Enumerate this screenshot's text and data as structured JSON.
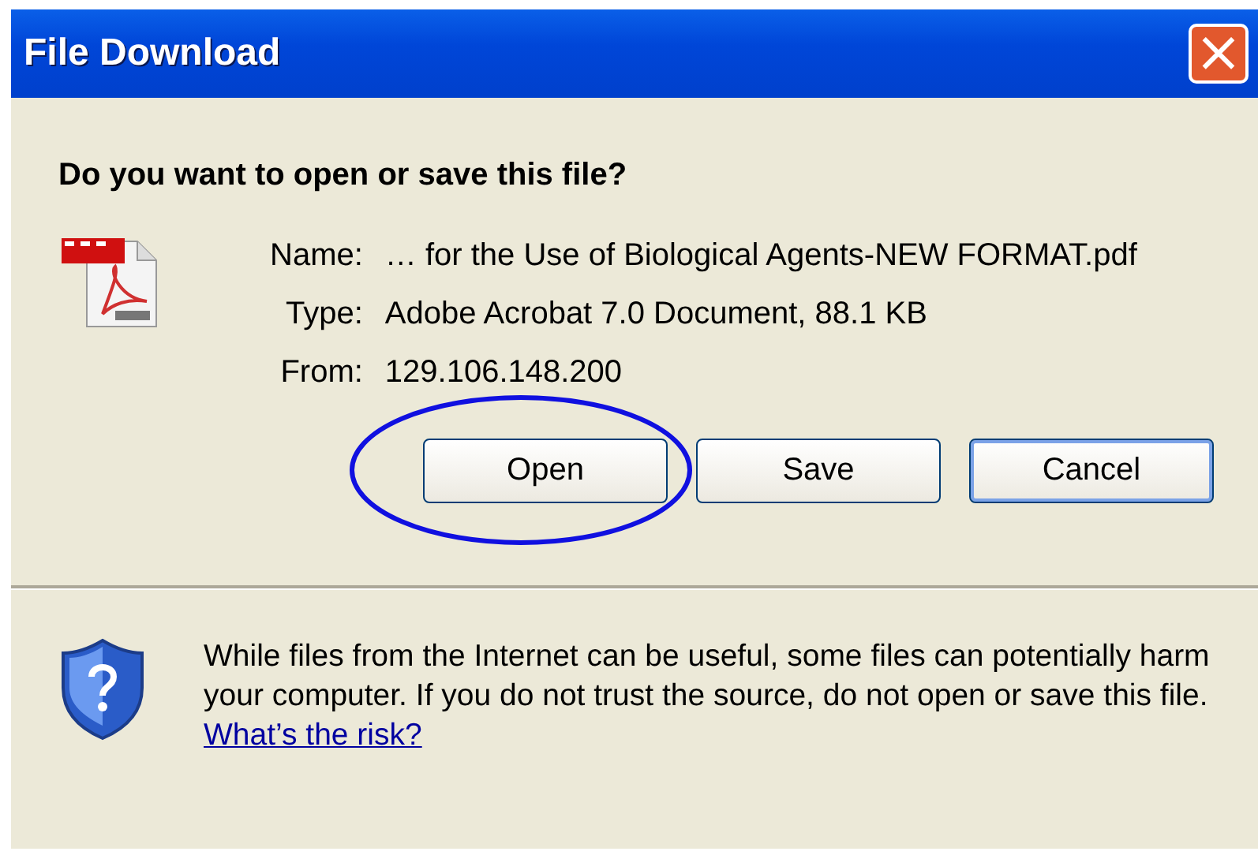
{
  "window": {
    "title": "File Download",
    "close_button": "×"
  },
  "question": "Do you want to open or save this file?",
  "details": [
    {
      "label": "Name:",
      "value": "… for the Use of Biological Agents-NEW FORMAT.pdf"
    },
    {
      "label": "Type:",
      "value": "Adobe Acrobat 7.0 Document, 88.1 KB"
    },
    {
      "label": "From:",
      "value": "129.106.148.200"
    }
  ],
  "buttons": [
    {
      "label": "Open",
      "focused": false,
      "circled": true
    },
    {
      "label": "Save",
      "focused": false,
      "circled": false
    },
    {
      "label": "Cancel",
      "focused": true,
      "circled": false
    }
  ],
  "warning": {
    "text": "While files from the Internet can be useful, some files can potentially harm your computer. If you do not trust the source, do not open or save this file.",
    "link": "What’s the risk?"
  }
}
